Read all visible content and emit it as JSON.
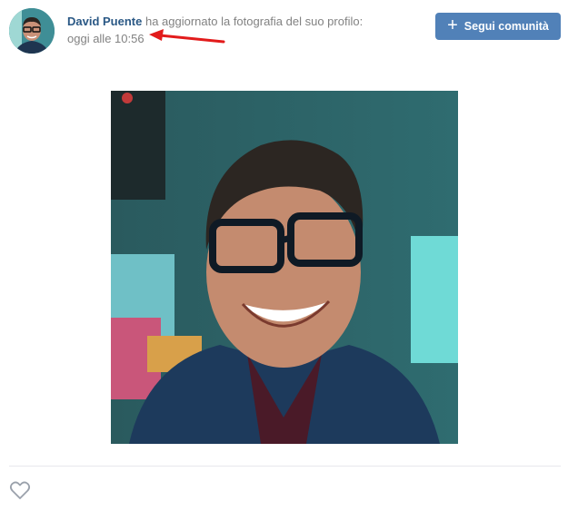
{
  "post": {
    "author_name": "David Puente",
    "action_text": " ha aggiornato la fotografia del suo profilo:",
    "timestamp": "oggi alle 10:56",
    "follow_button_label": "Segui comunità"
  },
  "icons": {
    "follow": "plus-icon",
    "like": "heart-icon",
    "annotation": "red-arrow"
  },
  "colors": {
    "link": "#2a5885",
    "muted": "#828282",
    "button": "#5181b8",
    "arrow": "#e21b1b"
  }
}
